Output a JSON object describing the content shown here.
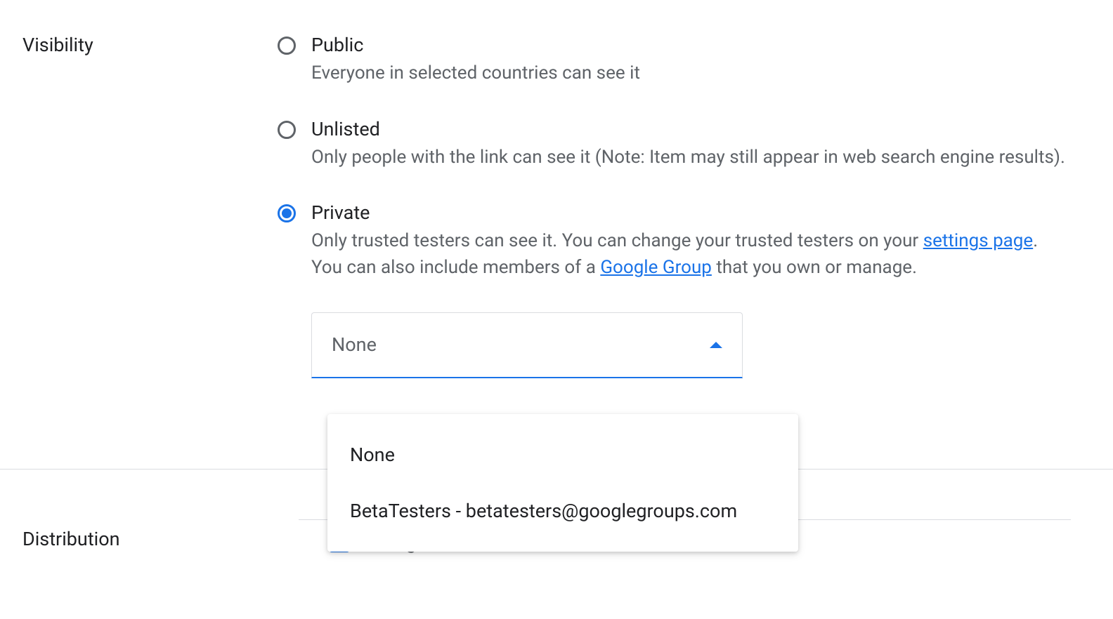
{
  "visibility": {
    "label": "Visibility",
    "options": [
      {
        "title": "Public",
        "desc": "Everyone in selected countries can see it",
        "selected": false
      },
      {
        "title": "Unlisted",
        "desc": "Only people with the link can see it (Note: Item may still appear in web search engine results).",
        "selected": false
      },
      {
        "title": "Private",
        "desc_part1": "Only trusted testers can see it. You can change your trusted testers on your ",
        "desc_link1": "settings page",
        "desc_part2": ".",
        "desc_part3": "You can also include members of a ",
        "desc_link2": "Google Group",
        "desc_part4": " that you own or manage.",
        "selected": true
      }
    ],
    "dropdown": {
      "value": "None",
      "options": [
        "None",
        "BetaTesters - betatesters@googlegroups.com"
      ]
    }
  },
  "distribution": {
    "label": "Distribution",
    "all_regions_label": "All regions"
  }
}
